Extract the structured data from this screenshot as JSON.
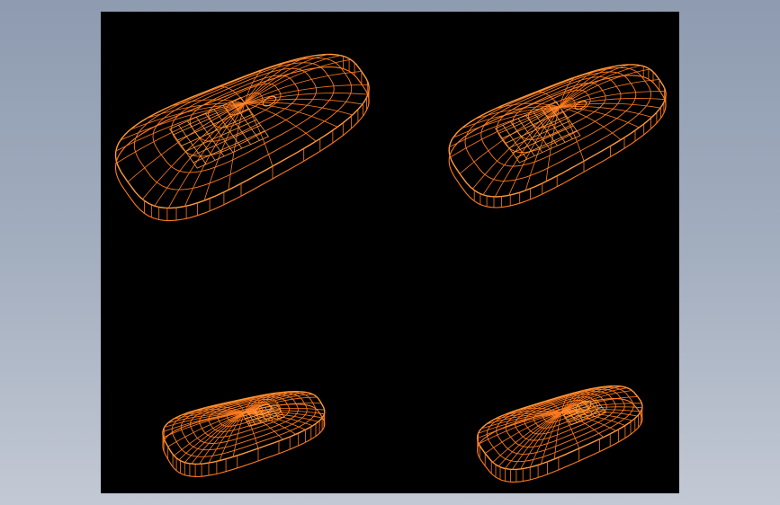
{
  "viewport": {
    "background": "#000000",
    "wire_color": "#ff7a1e",
    "wire_highlight": "#ff9a3c"
  },
  "models": [
    {
      "id": "view-top-left",
      "icon": "mouse-wireframe-icon"
    },
    {
      "id": "view-top-right",
      "icon": "mouse-wireframe-icon"
    },
    {
      "id": "view-bottom-left",
      "icon": "mouse-wireframe-icon"
    },
    {
      "id": "view-bottom-right",
      "icon": "mouse-wireframe-icon"
    }
  ]
}
